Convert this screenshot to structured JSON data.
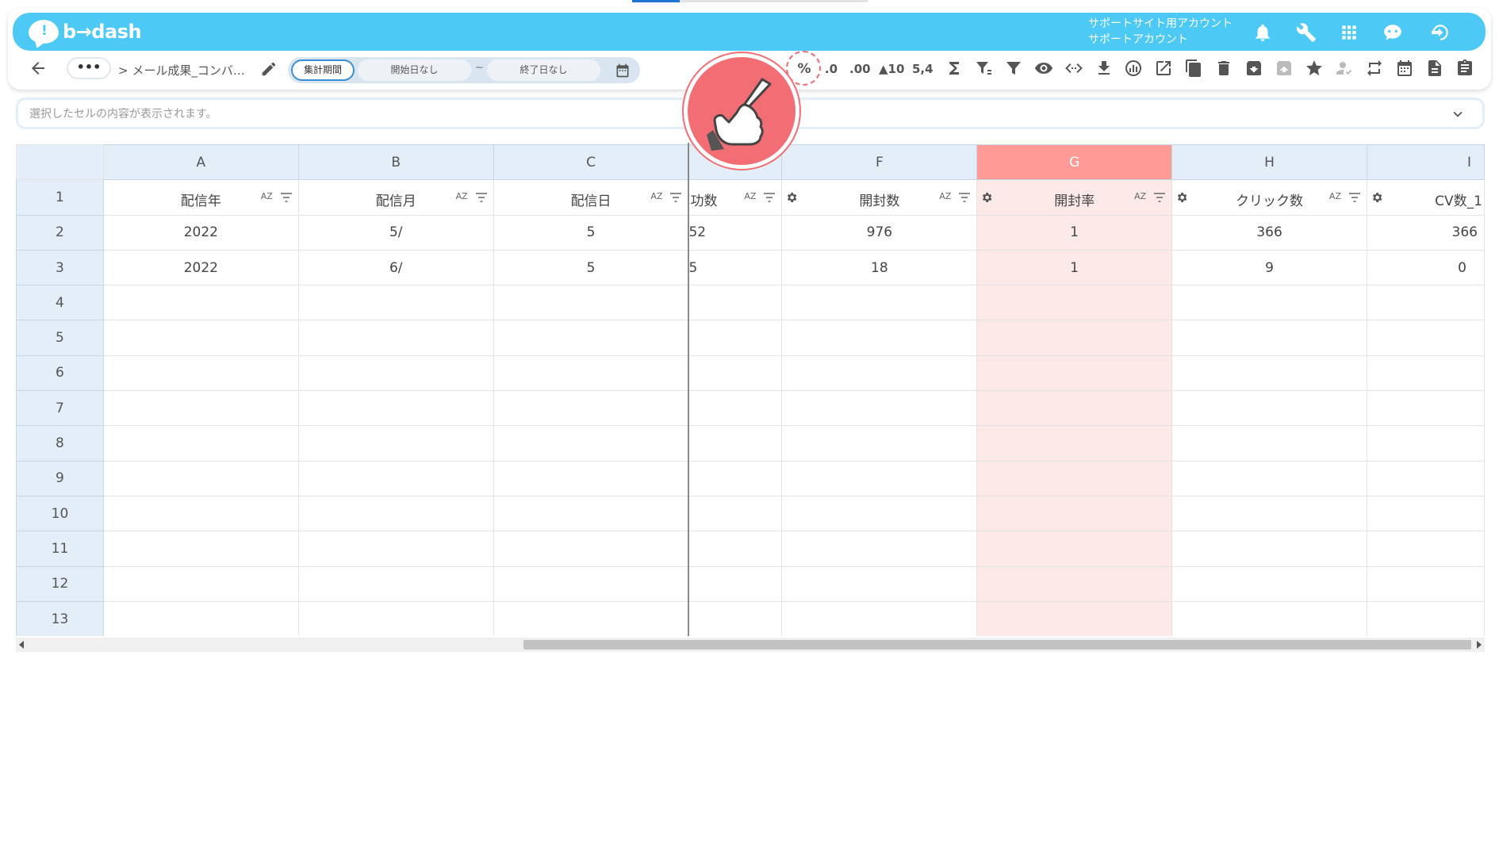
{
  "app": {
    "logo_mark": "!",
    "logo_text": "b→dash",
    "account_line1": "サポートサイト用アカウント",
    "account_line2": "サポートアカウント"
  },
  "header_icons": [
    "bell-icon",
    "wrench-icon",
    "apps-grid-icon",
    "chat-robot-icon",
    "logout-icon"
  ],
  "toolbar": {
    "more_label": "•••",
    "breadcrumb": "> メール成果_コンバ…",
    "period_label": "集計期間",
    "start_date": "開始日なし",
    "tilde": "~",
    "end_date": "終了日なし",
    "percent_label": "%",
    "decimal_decrease_label": ".0",
    "decimal_increase_label": ".00",
    "sort_label": "▲10",
    "rank_label": "5,4"
  },
  "formula_bar": {
    "placeholder": "選択したセルの内容が表示されます。"
  },
  "grid": {
    "columns": [
      "A",
      "B",
      "C",
      "",
      "F",
      "G",
      "H",
      "I"
    ],
    "selected_column": "G",
    "field_headers": [
      "配信年",
      "配信月",
      "配信日",
      "功数",
      "開封数",
      "開封率",
      "クリック数",
      "CV数_1"
    ],
    "row_numbers": [
      "1",
      "2",
      "3",
      "4",
      "5",
      "6",
      "7",
      "8",
      "9",
      "10",
      "11",
      "12",
      "13"
    ],
    "rows": [
      [
        "2022",
        "5/",
        "5",
        "52",
        "976",
        "1",
        "366",
        "366"
      ],
      [
        "2022",
        "6/",
        "5",
        "5",
        "18",
        "1",
        "9",
        "0"
      ]
    ],
    "sort_badge": "AZ"
  },
  "colors": {
    "header_bg": "#4cc9f5",
    "selected_col": "#ff9a96",
    "selected_cells": "#fde9e8",
    "highlight": "#f36d74"
  }
}
